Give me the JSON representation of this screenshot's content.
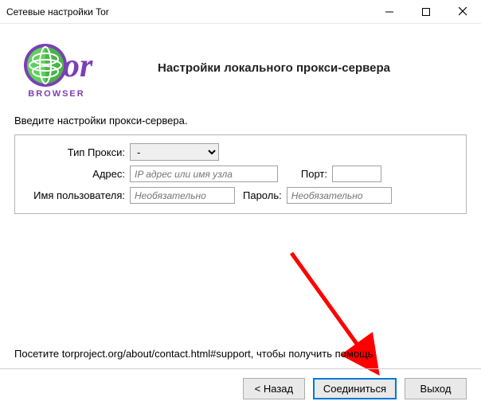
{
  "window": {
    "title": "Сетевые настройки Tor"
  },
  "logo": {
    "text_browser": "BROWSER"
  },
  "heading": "Настройки локального прокси-сервера",
  "intro": "Введите настройки прокси-сервера.",
  "form": {
    "proxy_type_label": "Тип Прокси:",
    "proxy_type_value": "-",
    "address_label": "Адрес:",
    "address_placeholder": "IP адрес или имя узла",
    "address_value": "",
    "port_label": "Порт:",
    "port_value": "",
    "username_label": "Имя пользователя:",
    "username_placeholder": "Необязательно",
    "username_value": "",
    "password_label": "Пароль:",
    "password_placeholder": "Необязательно",
    "password_value": ""
  },
  "footer_text": "Посетите torproject.org/about/contact.html#support, чтобы получить помощь",
  "buttons": {
    "back": "< Назад",
    "connect": "Соединиться",
    "exit": "Выход"
  }
}
